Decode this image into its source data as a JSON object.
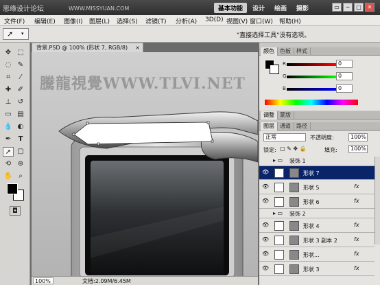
{
  "app": {
    "watermark_left": "思缘设计论坛",
    "watermark_url": "WWW.MISSYUAN.COM",
    "workspaces": [
      "基本功能",
      "设计",
      "绘画",
      "摄影"
    ],
    "window_buttons": [
      "▭",
      "─",
      "□",
      "✕"
    ]
  },
  "menu": {
    "items": [
      "文件(F)",
      "编辑(E)",
      "图像(I)",
      "图层(L)",
      "选择(S)",
      "滤镜(T)",
      "分析(A)",
      "3D(D)",
      "视图(V)",
      "窗口(W)",
      "帮助(H)"
    ]
  },
  "options": {
    "hint": "\"直接选择工具\"没有选项。"
  },
  "document": {
    "tab_title": "背景.PSD @ 100% (形状 7, RGB/8)",
    "close_glyph": "×",
    "watermark": "騰龍視覺WWW.TLVI.NET",
    "zoom": "100%",
    "doc_size": "文档:2.09M/6.45M"
  },
  "panels": {
    "color_tabs": [
      "颜色",
      "色板",
      "样式"
    ],
    "adjust_tabs": [
      "调整",
      "蒙版"
    ],
    "layer_tabs": [
      "图层",
      "通道",
      "路径"
    ],
    "rgb": [
      {
        "label": "R",
        "value": "0"
      },
      {
        "label": "G",
        "value": "0"
      },
      {
        "label": "B",
        "value": "0"
      }
    ],
    "blend_mode": "正常",
    "opacity_label": "不透明度:",
    "opacity": "100%",
    "lock_label": "锁定:",
    "fill_label": "填充:",
    "fill": "100%",
    "layers": [
      {
        "name": "装饰 1",
        "type": "group",
        "visible": false
      },
      {
        "name": "形状 7",
        "type": "shape",
        "visible": true,
        "selected": true,
        "fx": ""
      },
      {
        "name": "形状 5",
        "type": "shape",
        "visible": true,
        "fx": "fx"
      },
      {
        "name": "形状 6",
        "type": "shape",
        "visible": true,
        "fx": "fx"
      },
      {
        "name": "装饰 2",
        "type": "group",
        "visible": false
      },
      {
        "name": "形状 4",
        "type": "shape",
        "visible": true,
        "fx": "fx"
      },
      {
        "name": "形状 3 副本 2",
        "type": "shape",
        "visible": true,
        "fx": "fx"
      },
      {
        "name": "形状...",
        "type": "shape",
        "visible": true,
        "fx": "fx"
      },
      {
        "name": "形状 3",
        "type": "shape",
        "visible": true,
        "fx": "fx"
      }
    ]
  },
  "colors": {
    "foreground": "#000000",
    "background": "#ffffff",
    "selected_layer": "#0a246a"
  }
}
